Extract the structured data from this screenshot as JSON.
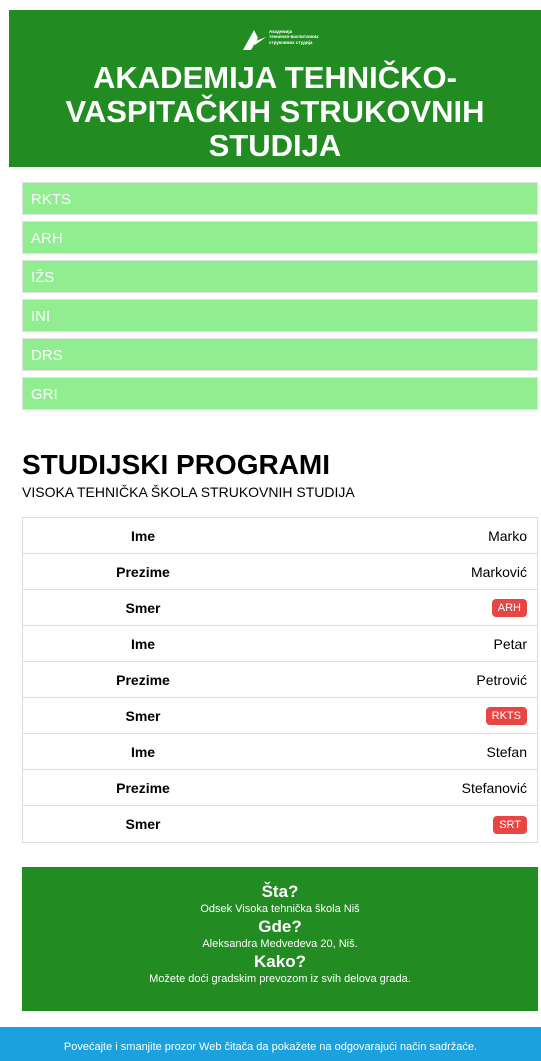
{
  "header": {
    "logo_lines": [
      "Академија",
      "техничко-васпитачких",
      "струковних студија"
    ],
    "title": "AKADEMIJA TEHNIČKO-VASPITAČKIH STRUKOVNIH STUDIJA"
  },
  "nav": {
    "items": [
      {
        "label": "RKTS"
      },
      {
        "label": "ARH"
      },
      {
        "label": "IŽS"
      },
      {
        "label": "INI"
      },
      {
        "label": "DRS"
      },
      {
        "label": "GRI"
      }
    ]
  },
  "section": {
    "title": "STUDIJSKI PROGRAMI",
    "subtitle": "VISOKA TEHNIČKA ŠKOLA STRUKOVNIH STUDIJA"
  },
  "students": [
    {
      "ime_label": "Ime",
      "ime": "Marko",
      "prezime_label": "Prezime",
      "prezime": "Marković",
      "smer_label": "Smer",
      "smer": "ARH"
    },
    {
      "ime_label": "Ime",
      "ime": "Petar",
      "prezime_label": "Prezime",
      "prezime": "Petrović",
      "smer_label": "Smer",
      "smer": "RKTS"
    },
    {
      "ime_label": "Ime",
      "ime": "Stefan",
      "prezime_label": "Prezime",
      "prezime": "Stefanović",
      "smer_label": "Smer",
      "smer": "SRT"
    }
  ],
  "info": {
    "sta_heading": "Šta?",
    "sta_text": "Odsek Visoka tehnička škola Niš",
    "gde_heading": "Gde?",
    "gde_text": "Aleksandra Medvedeva 20, Niš.",
    "kako_heading": "Kako?",
    "kako_text": "Možete doći gradskim prevozom iz svih delova grada."
  },
  "footer": {
    "text": "Povećajte i smanjite prozor Web čitača da pokažete na odgovarajući način sadržaće."
  },
  "colors": {
    "header_bg": "#228b22",
    "nav_bg": "#90ee90",
    "badge_bg": "#e84545",
    "footer_bg": "#1ba1dd"
  }
}
